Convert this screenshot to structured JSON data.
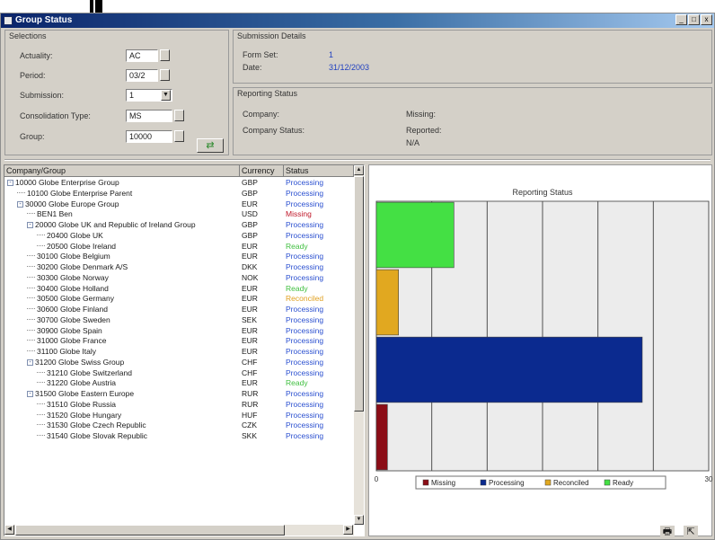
{
  "window": {
    "title": "Group Status"
  },
  "window_controls": [
    "_",
    "□",
    "x"
  ],
  "selections": {
    "title": "Selections",
    "actuality_label": "Actuality:",
    "actuality_value": "AC",
    "period_label": "Period:",
    "period_value": "03/2",
    "submission_label": "Submission:",
    "submission_value": "1",
    "consolidation_label": "Consolidation Type:",
    "consolidation_value": "MS",
    "group_label": "Group:",
    "group_value": "10000"
  },
  "submission_details": {
    "title": "Submission Details",
    "form_set_label": "Form Set:",
    "form_set_value": "1",
    "date_label": "Date:",
    "date_value": "31/12/2003"
  },
  "reporting_status": {
    "title": "Reporting Status",
    "company_label": "Company:",
    "company_status_label": "Company Status:",
    "missing_label": "Missing:",
    "reported_label": "Reported:",
    "na_label": "N/A"
  },
  "tree": {
    "columns": [
      "Company/Group",
      "Currency",
      "Status"
    ],
    "rows": [
      {
        "indent": 0,
        "toggle": "-",
        "name": "10000  Globe Enterprise Group",
        "currency": "GBP",
        "status": "Processing"
      },
      {
        "indent": 1,
        "toggle": "",
        "name": "10100  Globe Enterprise Parent",
        "currency": "GBP",
        "status": "Processing"
      },
      {
        "indent": 1,
        "toggle": "-",
        "name": "30000  Globe Europe Group",
        "currency": "EUR",
        "status": "Processing"
      },
      {
        "indent": 2,
        "toggle": "",
        "name": "BEN1  Ben",
        "currency": "USD",
        "status": "Missing"
      },
      {
        "indent": 2,
        "toggle": "-",
        "name": "20000  Globe UK and Republic of Ireland Group",
        "currency": "GBP",
        "status": "Processing"
      },
      {
        "indent": 3,
        "toggle": "",
        "name": "20400  Globe UK",
        "currency": "GBP",
        "status": "Processing"
      },
      {
        "indent": 3,
        "toggle": "",
        "name": "20500  Globe Ireland",
        "currency": "EUR",
        "status": "Ready"
      },
      {
        "indent": 2,
        "toggle": "",
        "name": "30100  Globe Belgium",
        "currency": "EUR",
        "status": "Processing"
      },
      {
        "indent": 2,
        "toggle": "",
        "name": "30200  Globe Denmark A/S",
        "currency": "DKK",
        "status": "Processing"
      },
      {
        "indent": 2,
        "toggle": "",
        "name": "30300  Globe Norway",
        "currency": "NOK",
        "status": "Processing"
      },
      {
        "indent": 2,
        "toggle": "",
        "name": "30400  Globe Holland",
        "currency": "EUR",
        "status": "Ready"
      },
      {
        "indent": 2,
        "toggle": "",
        "name": "30500  Globe Germany",
        "currency": "EUR",
        "status": "Reconciled"
      },
      {
        "indent": 2,
        "toggle": "",
        "name": "30600  Globe Finland",
        "currency": "EUR",
        "status": "Processing"
      },
      {
        "indent": 2,
        "toggle": "",
        "name": "30700  Globe Sweden",
        "currency": "SEK",
        "status": "Processing"
      },
      {
        "indent": 2,
        "toggle": "",
        "name": "30900  Globe Spain",
        "currency": "EUR",
        "status": "Processing"
      },
      {
        "indent": 2,
        "toggle": "",
        "name": "31000  Globe France",
        "currency": "EUR",
        "status": "Processing"
      },
      {
        "indent": 2,
        "toggle": "",
        "name": "31100  Globe Italy",
        "currency": "EUR",
        "status": "Processing"
      },
      {
        "indent": 2,
        "toggle": "-",
        "name": "31200  Globe Swiss Group",
        "currency": "CHF",
        "status": "Processing"
      },
      {
        "indent": 3,
        "toggle": "",
        "name": "31210  Globe Switzerland",
        "currency": "CHF",
        "status": "Processing"
      },
      {
        "indent": 3,
        "toggle": "",
        "name": "31220  Globe Austria",
        "currency": "EUR",
        "status": "Ready"
      },
      {
        "indent": 2,
        "toggle": "-",
        "name": "31500  Globe Eastern Europe",
        "currency": "RUR",
        "status": "Processing"
      },
      {
        "indent": 3,
        "toggle": "",
        "name": "31510  Globe Russia",
        "currency": "RUR",
        "status": "Processing"
      },
      {
        "indent": 3,
        "toggle": "",
        "name": "31520  Globe Hungary",
        "currency": "HUF",
        "status": "Processing"
      },
      {
        "indent": 3,
        "toggle": "",
        "name": "31530  Globe Czech Republic",
        "currency": "CZK",
        "status": "Processing"
      },
      {
        "indent": 3,
        "toggle": "",
        "name": "31540  Globe Slovak Republic",
        "currency": "SKK",
        "status": "Processing"
      }
    ]
  },
  "status_colors": {
    "Processing": "#2b50d0",
    "Missing": "#c0182a",
    "Ready": "#3fbf3f",
    "Reconciled": "#e0a020"
  },
  "chart_data": {
    "type": "bar",
    "orientation": "horizontal",
    "title": "Reporting Status",
    "categories": [
      "Missing",
      "Processing",
      "Reconciled",
      "Ready"
    ],
    "values": [
      1,
      24,
      2,
      7
    ],
    "colors": [
      "#8b0d16",
      "#0b2a8f",
      "#e1a820",
      "#44e044"
    ],
    "xlim": [
      0,
      30
    ],
    "xticks": [
      "0",
      "5",
      "10",
      "15",
      "20",
      "25",
      "30"
    ],
    "grid": true,
    "legend_position": "bottom"
  },
  "bottom_icons": [
    "printer-icon",
    "export-icon"
  ]
}
